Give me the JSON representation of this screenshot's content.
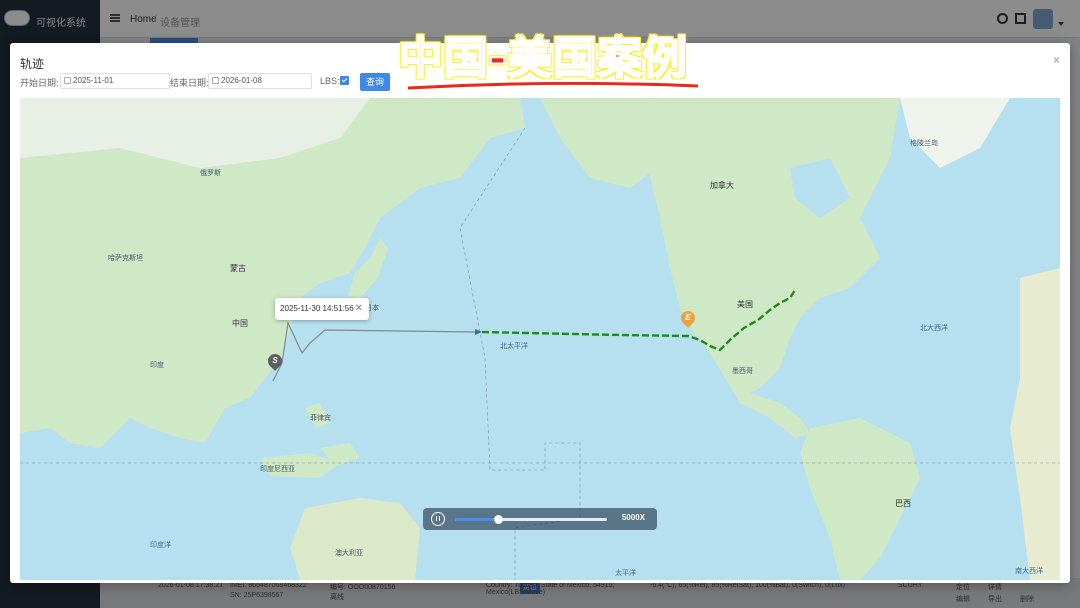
{
  "app": {
    "title": "可视化系统",
    "breadcrumb_home": "Home",
    "breadcrumb_sep": "/",
    "breadcrumb_current": "设备管理"
  },
  "background_row": {
    "time": "2026-01-08 17:38:21",
    "imei": "IMEI: 866487068468322",
    "sn": "SN: 25P6398567",
    "num": "编号: OOO00870156",
    "status": "离线",
    "btn": "定位",
    "address": "Country: Tutitlan, State of Mexico, 54915; Mexico(LBS/Move)",
    "sensor": "-6.4(°C), 65(%Rel), 85(%RelSat), 100(%Bat), 0(Switch), 0(Lux)",
    "model": "SCUHY",
    "links": [
      "定位",
      "详情",
      "编辑",
      "导出",
      "删除"
    ]
  },
  "dialog": {
    "title": "轨迹",
    "close": "×",
    "start_label": "开始日期:",
    "start_value": "2025-11-01",
    "end_label": "结束日期:",
    "end_value": "2026-01-08",
    "lbs_label": "LBS:",
    "lbs_checked": true,
    "query_label": "查询"
  },
  "banner": {
    "text": "中国-美国案例"
  },
  "map": {
    "tooltip_time": "2025-11-30 14:51:56",
    "tooltip_close": "✕",
    "start_marker": "S",
    "end_marker": "E",
    "labels": {
      "mongolia": "蒙古",
      "kazakhstan": "哈萨克斯坦",
      "china": "中国",
      "japan": "日本",
      "philippines": "菲律宾",
      "indonesia": "印度尼西亚",
      "australia": "澳大利亚",
      "india": "印度",
      "canada": "加拿大",
      "usa": "美国",
      "mexico": "墨西哥",
      "brazil": "巴西",
      "greenland": "格陵兰岛",
      "russia": "俄罗斯",
      "pacific_n": "北太平洋",
      "pacific_s": "太平洋",
      "atlantic_n": "北大西洋",
      "atlantic_s": "南大西洋",
      "indian_ocean": "印度洋"
    }
  },
  "player": {
    "speed": "5000X",
    "progress": 0.28
  },
  "colors": {
    "route_green": "#1e8a1e",
    "route_gray": "#7b8a95",
    "land": "#cfe9c6",
    "sea": "#b6dff0",
    "accent": "#3f88e8"
  }
}
